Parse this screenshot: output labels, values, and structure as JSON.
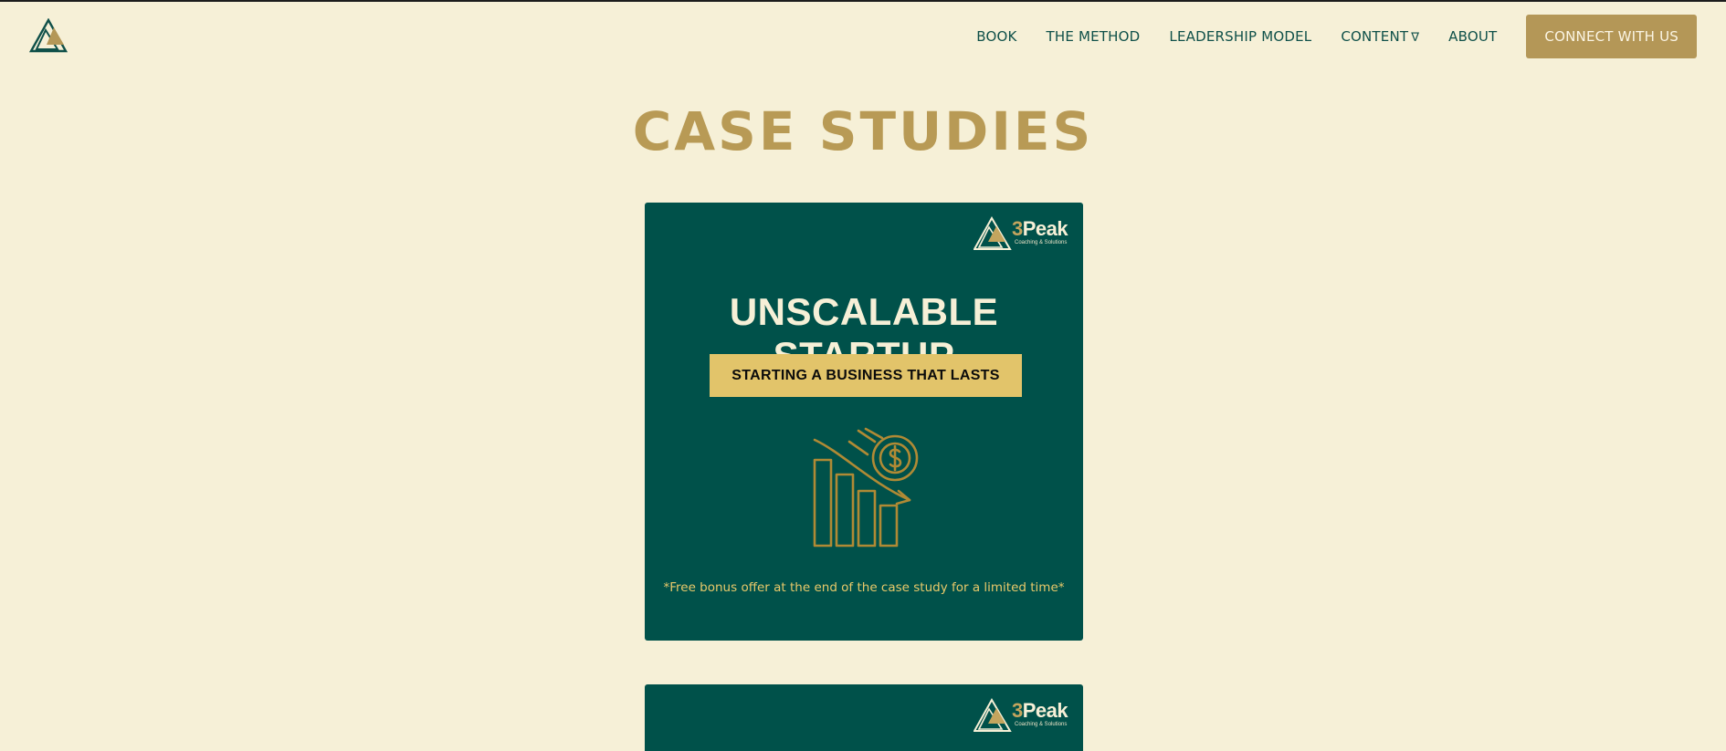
{
  "header": {
    "nav": [
      {
        "label": "BOOK"
      },
      {
        "label": "THE METHOD"
      },
      {
        "label": "LEADERSHIP MODEL"
      },
      {
        "label": "CONTENT",
        "caret": "∇"
      },
      {
        "label": "ABOUT"
      }
    ],
    "cta_label": "CONNECT WITH US",
    "logo_icon": "triangle-peak-logo-icon"
  },
  "page": {
    "title": "CASE STUDIES"
  },
  "cards": [
    {
      "brand_number": "3",
      "brand_word": "Peak",
      "brand_tagline": "Coaching & Solutions",
      "title": "UNSCALABLE STARTUP",
      "banner": "STARTING A BUSINESS THAT LASTS",
      "illustration_icon": "declining-revenue-chart-icon",
      "note": "*Free bonus offer at the end of the case study for a limited time*"
    },
    {
      "brand_number": "3",
      "brand_word": "Peak",
      "brand_tagline": "Coaching & Solutions"
    }
  ],
  "colors": {
    "background": "#f6f0d7",
    "nav_text": "#0f5049",
    "accent_gold": "#b49757",
    "card_green": "#00514a",
    "banner_yellow": "#e2c46a"
  }
}
